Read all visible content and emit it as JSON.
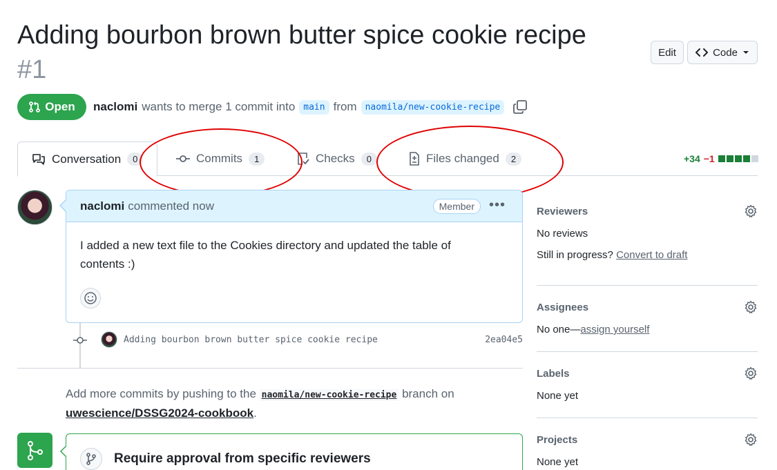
{
  "pr": {
    "title": "Adding bourbon brown butter spice cookie recipe",
    "number": "#1",
    "state": "Open",
    "author": "naclomi",
    "merge_text": "wants to merge 1 commit into",
    "base_branch": "main",
    "from_text": "from",
    "head_branch": "naomila/new-cookie-recipe"
  },
  "header_actions": {
    "edit_label": "Edit",
    "code_label": "Code"
  },
  "tabs": [
    {
      "label": "Conversation",
      "count": "0"
    },
    {
      "label": "Commits",
      "count": "1"
    },
    {
      "label": "Checks",
      "count": "0"
    },
    {
      "label": "Files changed",
      "count": "2"
    }
  ],
  "diffstat": {
    "additions": "+34",
    "deletions": "−1"
  },
  "comment": {
    "author": "naclomi",
    "action": "commented now",
    "role_badge": "Member",
    "body": "I added a new text file to the Cookies directory and updated the table of contents :)"
  },
  "commit": {
    "message": "Adding bourbon brown butter spice cookie recipe",
    "sha": "2ea04e5"
  },
  "push_hint": {
    "prefix": "Add more commits by pushing to the",
    "branch": "naomila/new-cookie-recipe",
    "middle": "branch on",
    "repo": "uwescience/DSSG2024-cookbook",
    "suffix": "."
  },
  "merge_box": {
    "title": "Require approval from specific reviewers"
  },
  "sidebar": {
    "reviewers": {
      "heading": "Reviewers",
      "value": "No reviews",
      "progress_text": "Still in progress?",
      "progress_link": "Convert to draft"
    },
    "assignees": {
      "heading": "Assignees",
      "value_prefix": "No one—",
      "value_link": "assign yourself"
    },
    "labels": {
      "heading": "Labels",
      "value": "None yet"
    },
    "projects": {
      "heading": "Projects",
      "value": "None yet"
    }
  },
  "colors": {
    "open_green": "#2da44e",
    "annotation_red": "#e00000",
    "link_blue": "#0969da"
  }
}
